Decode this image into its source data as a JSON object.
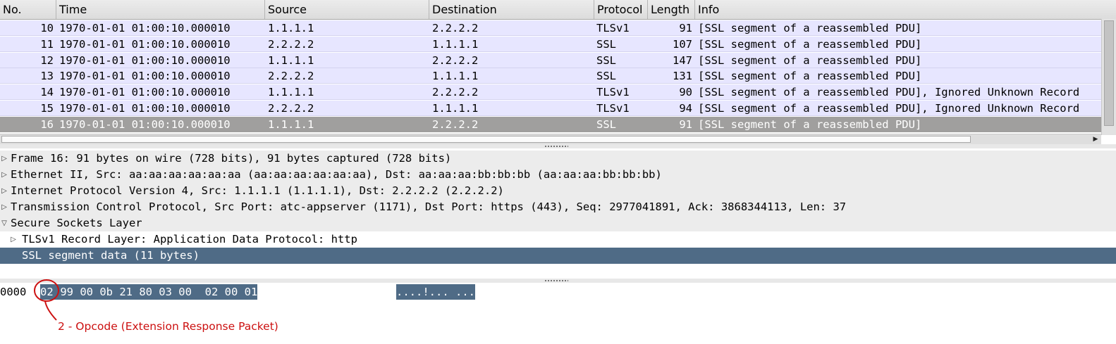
{
  "packet_list": {
    "columns": [
      "No.",
      "Time",
      "Source",
      "Destination",
      "Protocol",
      "Length",
      "Info"
    ],
    "rows": [
      {
        "no": "10",
        "time": "1970-01-01 01:00:10.000010",
        "source": "1.1.1.1",
        "destination": "2.2.2.2",
        "protocol": "TLSv1",
        "length": "91",
        "info": "[SSL segment of a reassembled PDU]"
      },
      {
        "no": "11",
        "time": "1970-01-01 01:00:10.000010",
        "source": "2.2.2.2",
        "destination": "1.1.1.1",
        "protocol": "SSL",
        "length": "107",
        "info": "[SSL segment of a reassembled PDU]"
      },
      {
        "no": "12",
        "time": "1970-01-01 01:00:10.000010",
        "source": "1.1.1.1",
        "destination": "2.2.2.2",
        "protocol": "SSL",
        "length": "147",
        "info": "[SSL segment of a reassembled PDU]"
      },
      {
        "no": "13",
        "time": "1970-01-01 01:00:10.000010",
        "source": "2.2.2.2",
        "destination": "1.1.1.1",
        "protocol": "SSL",
        "length": "131",
        "info": "[SSL segment of a reassembled PDU]"
      },
      {
        "no": "14",
        "time": "1970-01-01 01:00:10.000010",
        "source": "1.1.1.1",
        "destination": "2.2.2.2",
        "protocol": "TLSv1",
        "length": "90",
        "info": "[SSL segment of a reassembled PDU], Ignored Unknown Record"
      },
      {
        "no": "15",
        "time": "1970-01-01 01:00:10.000010",
        "source": "2.2.2.2",
        "destination": "1.1.1.1",
        "protocol": "TLSv1",
        "length": "94",
        "info": "[SSL segment of a reassembled PDU], Ignored Unknown Record"
      },
      {
        "no": "16",
        "time": "1970-01-01 01:00:10.000010",
        "source": "1.1.1.1",
        "destination": "2.2.2.2",
        "protocol": "SSL",
        "length": "91",
        "info": "[SSL segment of a reassembled PDU]"
      }
    ],
    "selected_row": "16",
    "scroll_right_arrow": "▶"
  },
  "details": {
    "rows": [
      {
        "text": "Frame 16: 91 bytes on wire (728 bits), 91 bytes captured (728 bits)",
        "arrow": "▷"
      },
      {
        "text": "Ethernet II, Src: aa:aa:aa:aa:aa:aa (aa:aa:aa:aa:aa:aa), Dst: aa:aa:aa:bb:bb:bb (aa:aa:aa:bb:bb:bb)",
        "arrow": "▷"
      },
      {
        "text": "Internet Protocol Version 4, Src: 1.1.1.1 (1.1.1.1), Dst: 2.2.2.2 (2.2.2.2)",
        "arrow": "▷"
      },
      {
        "text": "Transmission Control Protocol, Src Port: atc-appserver (1171), Dst Port: https (443), Seq: 2977041891, Ack: 3868344113, Len: 37",
        "arrow": "▷"
      },
      {
        "text": "Secure Sockets Layer",
        "arrow": "▽"
      },
      {
        "text": "TLSv1 Record Layer: Application Data Protocol: http",
        "arrow": "▷"
      },
      {
        "text": "SSL segment data (11 bytes)",
        "arrow": ""
      }
    ]
  },
  "bytes_pane": {
    "offset": "0000",
    "first_byte": "02",
    "rest_hex": " 99 00 0b 21 80 03 00  02 00 01",
    "ascii": "....!... ..."
  },
  "annotation": {
    "label": "2 - Opcode (Extension Response Packet)",
    "color": "#cc1010"
  },
  "colors": {
    "row_bg": "#e7e6ff",
    "selected_row_bg": "#a09f9e",
    "detail_selected_bg": "#4f6b86"
  }
}
